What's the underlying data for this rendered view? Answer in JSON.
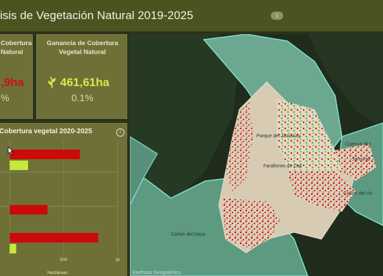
{
  "header": {
    "title": "isis de Vegetación Natural 2019-2025",
    "info_icon": "i"
  },
  "cards": {
    "loss": {
      "title_lines": [
        "Cobertura",
        "Natural"
      ],
      "value": ",9ha",
      "percent": "%",
      "value_color": "#c81414"
    },
    "gain": {
      "title_lines": [
        "Ganancia de Cobertura",
        "Vegetal Natural"
      ],
      "icon": "plant-icon",
      "value": "461,61ha",
      "percent": "0.1%",
      "value_color": "#d9e84a"
    }
  },
  "chart": {
    "title": "Cobertura vegetal 2020-2025",
    "info_icon": "i",
    "xlabel": "Hectáreas"
  },
  "chart_data": {
    "type": "bar",
    "orientation": "horizontal",
    "title": "Cobertura vegetal 2020-2025",
    "xlabel": "Hectáreas",
    "x_ticks": [
      "500",
      "1k"
    ],
    "xlim": [
      -90,
      1000
    ],
    "series": [
      {
        "color": "#cc0a0a",
        "values": [
          650,
          350,
          820
        ]
      },
      {
        "color": "#c5e83a",
        "values": [
          170,
          0,
          60
        ]
      }
    ]
  },
  "map": {
    "labels": [
      "Parque del Jamanay",
      "Farallones de Cali",
      "Cañón del río",
      "Cañón del Naya",
      "Cuenca alta",
      "Jamundí"
    ],
    "attribution": "Earthstar Geographics"
  },
  "colors": {
    "header_bg": "#4b5320",
    "panel_bg": "#6f7038",
    "loss": "#cc0a0a",
    "gain": "#c5e83a"
  }
}
